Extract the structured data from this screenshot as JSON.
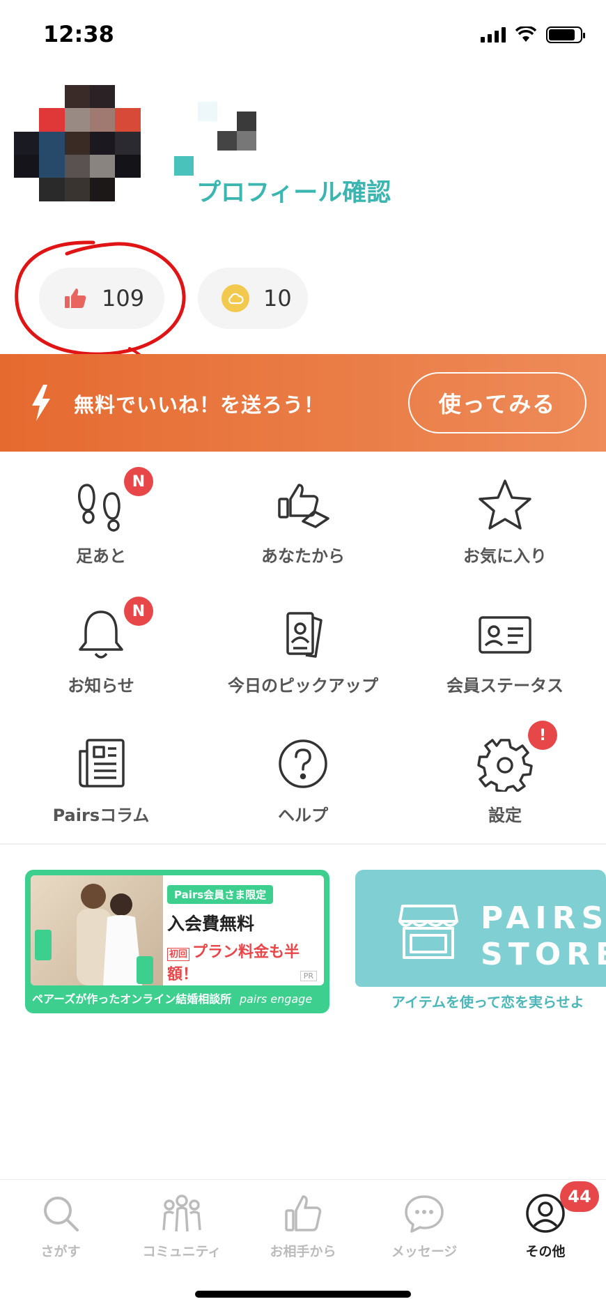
{
  "status_bar": {
    "time": "12:38"
  },
  "profile": {
    "link_label": "プロフィール確認"
  },
  "counters": {
    "likes": {
      "value": "109",
      "icon": "thumbs-up-icon"
    },
    "points": {
      "value": "10",
      "icon": "cloud-coin-icon"
    }
  },
  "banner": {
    "text": "無料でいいね！を送ろう！",
    "button": "使ってみる"
  },
  "menu": [
    {
      "label": "足あと",
      "icon": "footprints-icon",
      "badge": "N"
    },
    {
      "label": "あなたから",
      "icon": "thumbs-up-send-icon"
    },
    {
      "label": "お気に入り",
      "icon": "star-icon"
    },
    {
      "label": "お知らせ",
      "icon": "bell-icon",
      "badge": "N"
    },
    {
      "label": "今日のピックアップ",
      "icon": "profile-cards-icon"
    },
    {
      "label": "会員ステータス",
      "icon": "id-card-icon"
    },
    {
      "label": "Pairsコラム",
      "icon": "newspaper-icon"
    },
    {
      "label": "ヘルプ",
      "icon": "help-icon"
    },
    {
      "label": "設定",
      "icon": "gear-icon",
      "badge": "!"
    }
  ],
  "promos": {
    "engage": {
      "tag": "Pairs会員さま限定",
      "headline": "入会費無料",
      "subline": "プラン料金も半額！",
      "first_label": "初回",
      "pr": "PR",
      "footer": "ペアーズが作ったオンライン結婚相談所",
      "logo": "pairs engage"
    },
    "store": {
      "title_line1": "PAIRS",
      "title_line2": "STORE",
      "footer": "アイテムを使って恋を実らせよ"
    }
  },
  "tabbar": [
    {
      "label": "さがす",
      "icon": "search-icon"
    },
    {
      "label": "コミュニティ",
      "icon": "community-icon"
    },
    {
      "label": "お相手から",
      "icon": "thumbs-up-icon"
    },
    {
      "label": "メッセージ",
      "icon": "message-icon"
    },
    {
      "label": "その他",
      "icon": "user-circle-icon",
      "badge": "44",
      "active": true
    }
  ],
  "colors": {
    "accent_teal": "#3bb5b0",
    "banner_orange": "#e56a30",
    "badge_red": "#e8474a",
    "engage_green": "#3ccf8e",
    "store_teal": "#7fcfd3"
  }
}
